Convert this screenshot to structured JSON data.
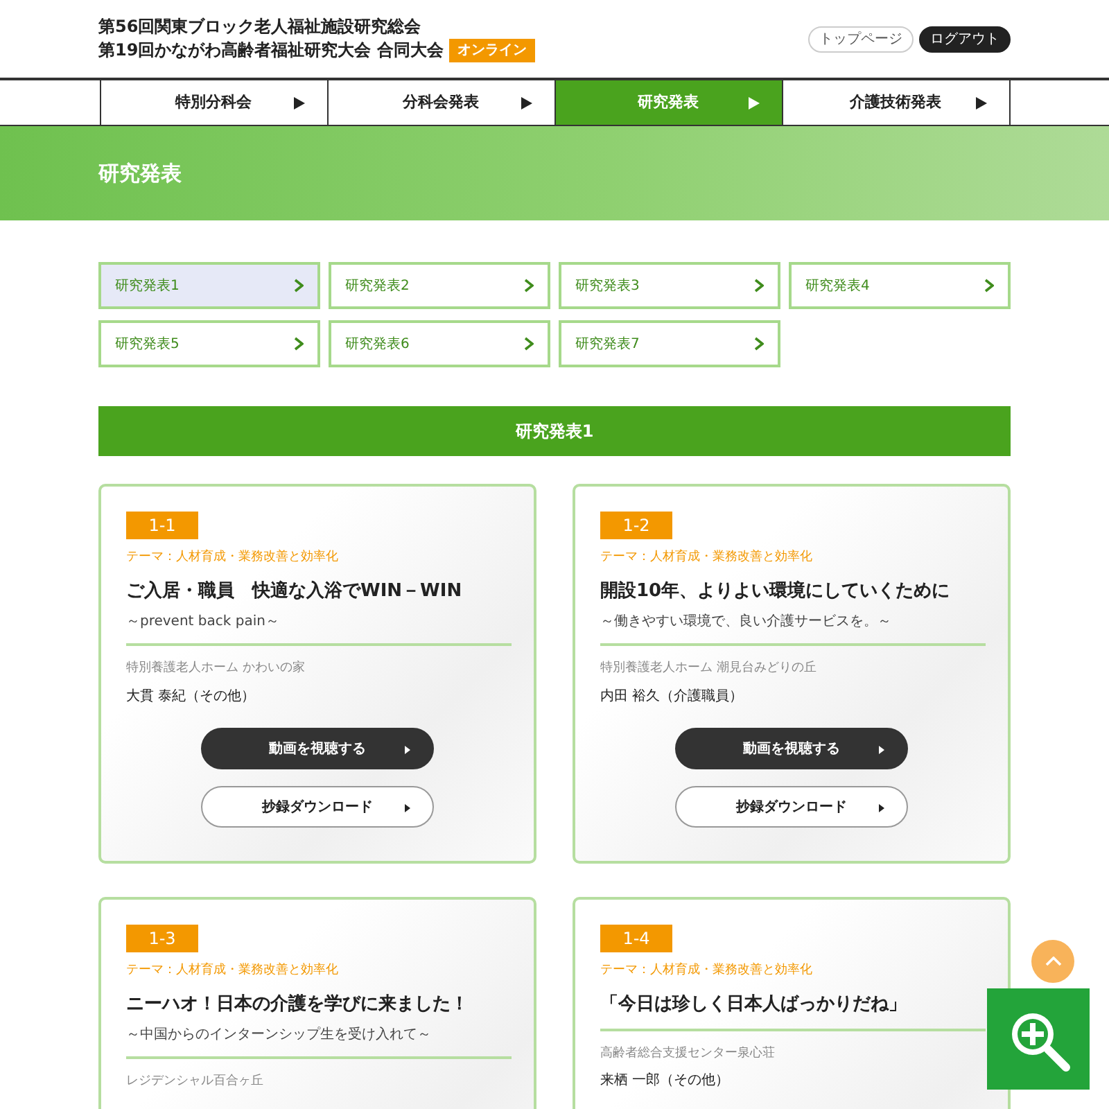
{
  "header": {
    "title_lines": [
      "第56回関東ブロック老人福祉施設研究総会",
      "第19回かながわ高齢者福祉研究大会 合同大会"
    ],
    "badge": "オンライン",
    "links": [
      {
        "label": "トップページ",
        "kind": "light"
      },
      {
        "label": "ログアウト",
        "kind": "dark"
      }
    ]
  },
  "nav": [
    {
      "label": "特別分科会",
      "selected": false
    },
    {
      "label": "分科会発表",
      "selected": false
    },
    {
      "label": "研究発表",
      "selected": true
    },
    {
      "label": "介護技術発表",
      "selected": false
    }
  ],
  "hero": {
    "title": "研究発表"
  },
  "subnav": [
    {
      "label": "研究発表1",
      "selected": true
    },
    {
      "label": "研究発表2",
      "selected": false
    },
    {
      "label": "研究発表3",
      "selected": false
    },
    {
      "label": "研究発表4",
      "selected": false
    },
    {
      "label": "研究発表5",
      "selected": false
    },
    {
      "label": "研究発表6",
      "selected": false
    },
    {
      "label": "研究発表7",
      "selected": false
    }
  ],
  "section_title": "研究発表1",
  "cards": [
    {
      "number": "1-1",
      "theme": "テーマ：人材育成・業務改善と効率化",
      "title": "ご入居・職員　快適な入浴でWIN－WIN",
      "subtitle": "～prevent back pain～",
      "organization": "特別養護老人ホーム かわいの家",
      "presenter": "大貫 泰紀（その他）",
      "buttons": [
        {
          "label": "動画を視聴する",
          "kind": "dark"
        },
        {
          "label": "抄録ダウンロード",
          "kind": "light"
        }
      ]
    },
    {
      "number": "1-2",
      "theme": "テーマ：人材育成・業務改善と効率化",
      "title": "開設10年、よりよい環境にしていくために",
      "subtitle": "～働きやすい環境で、良い介護サービスを。～",
      "organization": "特別養護老人ホーム 潮見台みどりの丘",
      "presenter": "内田 裕久（介護職員）",
      "buttons": [
        {
          "label": "動画を視聴する",
          "kind": "dark"
        },
        {
          "label": "抄録ダウンロード",
          "kind": "light"
        }
      ]
    },
    {
      "number": "1-3",
      "theme": "テーマ：人材育成・業務改善と効率化",
      "title": "ニーハオ！日本の介護を学びに来ました！",
      "subtitle": "～中国からのインターンシップ生を受け入れて～",
      "organization": "レジデンシャル百合ヶ丘"
    },
    {
      "number": "1-4",
      "theme": "テーマ：人材育成・業務改善と効率化",
      "title": "「今日は珍しく日本人ばっかりだね」",
      "organization": "高齢者総合支援センター泉心荘",
      "presenter": "来栖 一郎（その他）"
    }
  ]
}
